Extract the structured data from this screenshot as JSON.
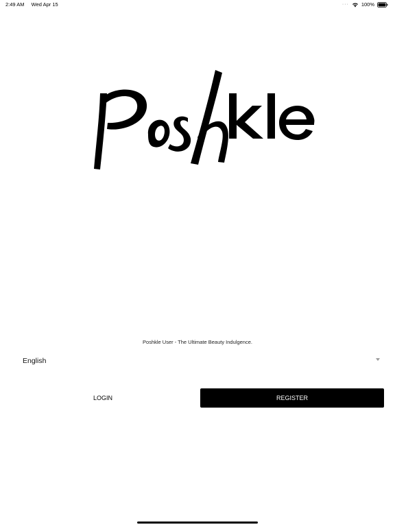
{
  "status_bar": {
    "time": "2:49 AM",
    "date": "Wed Apr 15",
    "battery": "100%",
    "icons": [
      "wifi-icon",
      "battery-icon"
    ]
  },
  "logo": {
    "brand": "Poshkle"
  },
  "tagline": "Poshkle User - The Ultimate Beauty Indulgence.",
  "language": {
    "selected": "English",
    "icon": "caret-down-icon"
  },
  "buttons": {
    "login": "LOGIN",
    "register": "REGISTER"
  },
  "colors": {
    "background": "#ffffff",
    "primary": "#000000",
    "primary_text": "#ffffff"
  }
}
